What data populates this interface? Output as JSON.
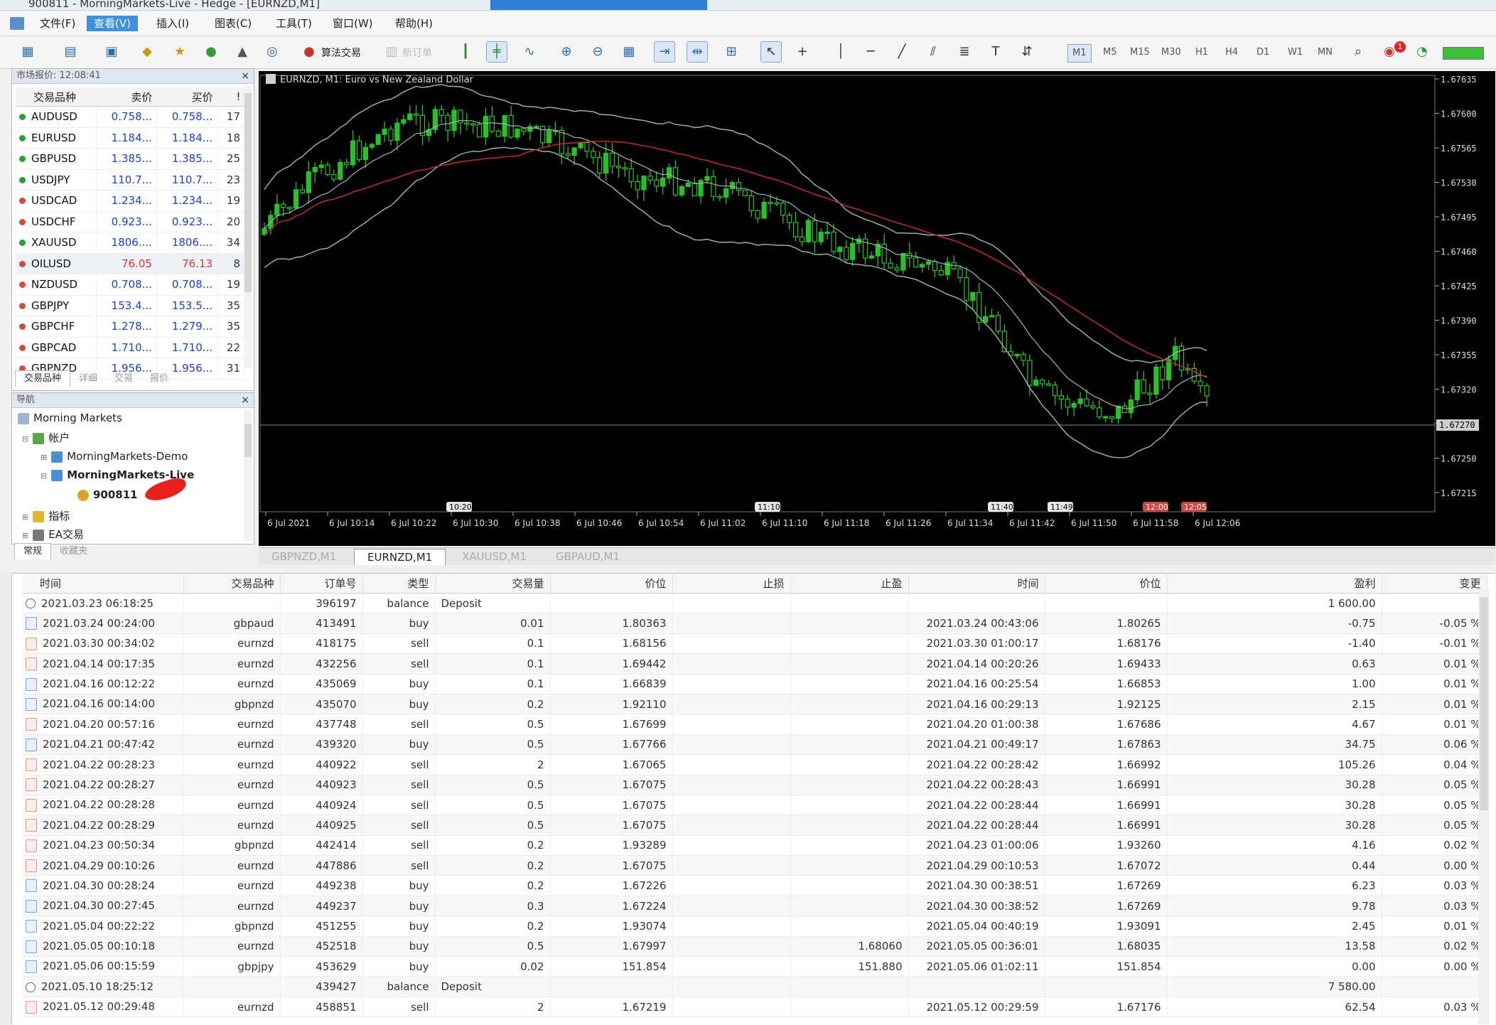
{
  "window": {
    "title": "900811 - MorningMarkets-Live - Hedge - [EURNZD,M1]"
  },
  "menu": [
    "文件(F)",
    "查看(V)",
    "插入(I)",
    "图表(C)",
    "工具(T)",
    "窗口(W)",
    "帮助(H)"
  ],
  "menu_active_index": 1,
  "toolbar": {
    "algo_label": "算法交易",
    "neworder_label": "新订单",
    "timeframes": [
      "M1",
      "M5",
      "M15",
      "M30",
      "H1",
      "H4",
      "D1",
      "W1",
      "MN"
    ],
    "active_timeframe": "M1",
    "notify_count": "1"
  },
  "market_watch": {
    "title": "市场报价: 12:08:41",
    "headers": {
      "symbol": "交易品种",
      "bid": "卖价",
      "ask": "买价",
      "spread": "!"
    },
    "rows": [
      {
        "symbol": "AUDUSD",
        "bid": "0.758...",
        "ask": "0.758...",
        "spread": "17",
        "dot": "#27a035"
      },
      {
        "symbol": "EURUSD",
        "bid": "1.184...",
        "ask": "1.184...",
        "spread": "18",
        "dot": "#27a035"
      },
      {
        "symbol": "GBPUSD",
        "bid": "1.385...",
        "ask": "1.385...",
        "spread": "25",
        "dot": "#27a035"
      },
      {
        "symbol": "USDJPY",
        "bid": "110.7...",
        "ask": "110.7...",
        "spread": "23",
        "dot": "#27a035"
      },
      {
        "symbol": "USDCAD",
        "bid": "1.234...",
        "ask": "1.234...",
        "spread": "19",
        "dot": "#d44b3a"
      },
      {
        "symbol": "USDCHF",
        "bid": "0.923...",
        "ask": "0.923...",
        "spread": "20",
        "dot": "#d44b3a"
      },
      {
        "symbol": "XAUUSD",
        "bid": "1806....",
        "ask": "1806....",
        "spread": "34",
        "dot": "#27a035"
      },
      {
        "symbol": "OILUSD",
        "bid": "76.05",
        "ask": "76.13",
        "spread": "8",
        "dot": "#d44b3a"
      },
      {
        "symbol": "NZDUSD",
        "bid": "0.708...",
        "ask": "0.708...",
        "spread": "19",
        "dot": "#d44b3a"
      },
      {
        "symbol": "GBPJPY",
        "bid": "153.4...",
        "ask": "153.5...",
        "spread": "35",
        "dot": "#d44b3a"
      },
      {
        "symbol": "GBPCHF",
        "bid": "1.278...",
        "ask": "1.279...",
        "spread": "35",
        "dot": "#d44b3a"
      },
      {
        "symbol": "GBPCAD",
        "bid": "1.710...",
        "ask": "1.710...",
        "spread": "22",
        "dot": "#d44b3a"
      },
      {
        "symbol": "GBPNZD",
        "bid": "1.956...",
        "ask": "1.956...",
        "spread": "31",
        "dot": "#d44b3a"
      }
    ],
    "tabs": [
      "交易品种",
      "详细",
      "交易",
      "报价"
    ]
  },
  "navigator": {
    "title": "导航",
    "root": "Morning Markets",
    "accounts_label": "帐户",
    "demo": "MorningMarkets-Demo",
    "live": "MorningMarkets-Live",
    "account_id": "900811",
    "indicators_label": "指标",
    "ea_label": "EA交易",
    "tabs": [
      "常规",
      "收藏夹"
    ]
  },
  "chart": {
    "symbol_label": "EURNZD, M1:  Euro vs New Zealand Dollar",
    "price_labels": [
      "1.67635",
      "1.67600",
      "1.67565",
      "1.67530",
      "1.67495",
      "1.67460",
      "1.67425",
      "1.67390",
      "1.67355",
      "1.67320",
      "1.67285",
      "1.67250",
      "1.67215"
    ],
    "current_price": "1.67270",
    "time_labels": [
      "6 Jul 2021",
      "6 Jul 10:14",
      "6 Jul 10:22",
      "6 Jul 10:30",
      "6 Jul 10:38",
      "6 Jul 10:46",
      "6 Jul 10:54",
      "6 Jul 11:02",
      "6 Jul 11:10",
      "6 Jul 11:18",
      "6 Jul 11:26",
      "6 Jul 11:34",
      "6 Jul 11:42",
      "6 Jul 11:50",
      "6 Jul 11:58",
      "6 Jul 12:06"
    ],
    "markers": [
      {
        "label": "10:20",
        "color": "#ffffff"
      },
      {
        "label": "11:10",
        "color": "#ffffff"
      },
      {
        "label": "11:40",
        "color": "#ffffff"
      },
      {
        "label": "11:49",
        "color": "#ffffff"
      },
      {
        "label": "12:00",
        "color": "#e05050"
      },
      {
        "label": "12:05",
        "color": "#e05050"
      }
    ],
    "candle_color": "#26c226",
    "band_color": "#9fb8b0",
    "ma_color": "#b52b2b"
  },
  "chart_tabs": [
    "GBPNZD,M1",
    "EURNZD,M1",
    "XAUUSD,M1",
    "GBPAUD,M1"
  ],
  "chart_tab_active": 1,
  "terminal": {
    "headers": [
      "时间",
      "交易品种",
      "订单号",
      "类型",
      "交易量",
      "价位",
      "止损",
      "止盈",
      "时间",
      "价位",
      "盈利",
      "变更"
    ],
    "rows": [
      {
        "icon": "bal",
        "time": "2021.03.23 06:18:25",
        "sym": "",
        "order": "396197",
        "type": "balance",
        "vol": "Deposit",
        "price": "",
        "sl": "",
        "tp": "",
        "ctime": "",
        "cprice": "",
        "profit": "1 600.00",
        "change": "",
        "pc": "zero"
      },
      {
        "icon": "buy",
        "time": "2021.03.24 00:24:00",
        "sym": "gbpaud",
        "order": "413491",
        "type": "buy",
        "vol": "0.01",
        "price": "1.80363",
        "sl": "",
        "tp": "",
        "ctime": "2021.03.24 00:43:06",
        "cprice": "1.80265",
        "profit": "-0.75",
        "change": "-0.05 %",
        "pc": "neg"
      },
      {
        "icon": "sell",
        "time": "2021.03.30 00:34:02",
        "sym": "eurnzd",
        "order": "418175",
        "type": "sell",
        "vol": "0.1",
        "price": "1.68156",
        "sl": "",
        "tp": "",
        "ctime": "2021.03.30 01:00:17",
        "cprice": "1.68176",
        "profit": "-1.40",
        "change": "-0.01 %",
        "pc": "neg"
      },
      {
        "icon": "sell",
        "time": "2021.04.14 00:17:35",
        "sym": "eurnzd",
        "order": "432256",
        "type": "sell",
        "vol": "0.1",
        "price": "1.69442",
        "sl": "",
        "tp": "",
        "ctime": "2021.04.14 00:20:26",
        "cprice": "1.69433",
        "profit": "0.63",
        "change": "0.01 %",
        "pc": "pos"
      },
      {
        "icon": "buy",
        "time": "2021.04.16 00:12:22",
        "sym": "eurnzd",
        "order": "435069",
        "type": "buy",
        "vol": "0.1",
        "price": "1.66839",
        "sl": "",
        "tp": "",
        "ctime": "2021.04.16 00:25:54",
        "cprice": "1.66853",
        "profit": "1.00",
        "change": "0.01 %",
        "pc": "pos"
      },
      {
        "icon": "buy",
        "time": "2021.04.16 00:14:00",
        "sym": "gbpnzd",
        "order": "435070",
        "type": "buy",
        "vol": "0.2",
        "price": "1.92110",
        "sl": "",
        "tp": "",
        "ctime": "2021.04.16 00:29:13",
        "cprice": "1.92125",
        "profit": "2.15",
        "change": "0.01 %",
        "pc": "pos"
      },
      {
        "icon": "sell",
        "time": "2021.04.20 00:57:16",
        "sym": "eurnzd",
        "order": "437748",
        "type": "sell",
        "vol": "0.5",
        "price": "1.67699",
        "sl": "",
        "tp": "",
        "ctime": "2021.04.20 01:00:38",
        "cprice": "1.67686",
        "profit": "4.67",
        "change": "0.01 %",
        "pc": "pos"
      },
      {
        "icon": "buy",
        "time": "2021.04.21 00:47:42",
        "sym": "eurnzd",
        "order": "439320",
        "type": "buy",
        "vol": "0.5",
        "price": "1.67766",
        "sl": "",
        "tp": "",
        "ctime": "2021.04.21 00:49:17",
        "cprice": "1.67863",
        "profit": "34.75",
        "change": "0.06 %",
        "pc": "pos"
      },
      {
        "icon": "sell",
        "time": "2021.04.22 00:28:23",
        "sym": "eurnzd",
        "order": "440922",
        "type": "sell",
        "vol": "2",
        "price": "1.67065",
        "sl": "",
        "tp": "",
        "ctime": "2021.04.22 00:28:42",
        "cprice": "1.66992",
        "profit": "105.26",
        "change": "0.04 %",
        "pc": "pos"
      },
      {
        "icon": "sell",
        "time": "2021.04.22 00:28:27",
        "sym": "eurnzd",
        "order": "440923",
        "type": "sell",
        "vol": "0.5",
        "price": "1.67075",
        "sl": "",
        "tp": "",
        "ctime": "2021.04.22 00:28:43",
        "cprice": "1.66991",
        "profit": "30.28",
        "change": "0.05 %",
        "pc": "pos"
      },
      {
        "icon": "sell",
        "time": "2021.04.22 00:28:28",
        "sym": "eurnzd",
        "order": "440924",
        "type": "sell",
        "vol": "0.5",
        "price": "1.67075",
        "sl": "",
        "tp": "",
        "ctime": "2021.04.22 00:28:44",
        "cprice": "1.66991",
        "profit": "30.28",
        "change": "0.05 %",
        "pc": "pos"
      },
      {
        "icon": "sell",
        "time": "2021.04.22 00:28:29",
        "sym": "eurnzd",
        "order": "440925",
        "type": "sell",
        "vol": "0.5",
        "price": "1.67075",
        "sl": "",
        "tp": "",
        "ctime": "2021.04.22 00:28:44",
        "cprice": "1.66991",
        "profit": "30.28",
        "change": "0.05 %",
        "pc": "pos"
      },
      {
        "icon": "sell",
        "time": "2021.04.23 00:50:34",
        "sym": "gbpnzd",
        "order": "442414",
        "type": "sell",
        "vol": "0.2",
        "price": "1.93289",
        "sl": "",
        "tp": "",
        "ctime": "2021.04.23 01:00:06",
        "cprice": "1.93260",
        "profit": "4.16",
        "change": "0.02 %",
        "pc": "pos"
      },
      {
        "icon": "sell",
        "time": "2021.04.29 00:10:26",
        "sym": "eurnzd",
        "order": "447886",
        "type": "sell",
        "vol": "0.2",
        "price": "1.67075",
        "sl": "",
        "tp": "",
        "ctime": "2021.04.29 00:10:53",
        "cprice": "1.67072",
        "profit": "0.44",
        "change": "0.00 %",
        "pc": "pos"
      },
      {
        "icon": "buy",
        "time": "2021.04.30 00:28:24",
        "sym": "eurnzd",
        "order": "449238",
        "type": "buy",
        "vol": "0.2",
        "price": "1.67226",
        "sl": "",
        "tp": "",
        "ctime": "2021.04.30 00:38:51",
        "cprice": "1.67269",
        "profit": "6.23",
        "change": "0.03 %",
        "pc": "pos"
      },
      {
        "icon": "buy",
        "time": "2021.04.30 00:27:45",
        "sym": "eurnzd",
        "order": "449237",
        "type": "buy",
        "vol": "0.3",
        "price": "1.67224",
        "sl": "",
        "tp": "",
        "ctime": "2021.04.30 00:38:52",
        "cprice": "1.67269",
        "profit": "9.78",
        "change": "0.03 %",
        "pc": "pos"
      },
      {
        "icon": "buy",
        "time": "2021.05.04 00:22:22",
        "sym": "gbpnzd",
        "order": "451255",
        "type": "buy",
        "vol": "0.2",
        "price": "1.93074",
        "sl": "",
        "tp": "",
        "ctime": "2021.05.04 00:40:19",
        "cprice": "1.93091",
        "profit": "2.45",
        "change": "0.01 %",
        "pc": "pos"
      },
      {
        "icon": "buy",
        "time": "2021.05.05 00:10:18",
        "sym": "eurnzd",
        "order": "452518",
        "type": "buy",
        "vol": "0.5",
        "price": "1.67997",
        "sl": "",
        "tp": "1.68060",
        "ctime": "2021.05.05 00:36:01",
        "cprice": "1.68035",
        "profit": "13.58",
        "change": "0.02 %",
        "pc": "pos"
      },
      {
        "icon": "buy",
        "time": "2021.05.06 00:15:59",
        "sym": "gbpjpy",
        "order": "453629",
        "type": "buy",
        "vol": "0.02",
        "price": "151.854",
        "sl": "",
        "tp": "151.880",
        "ctime": "2021.05.06 01:02:11",
        "cprice": "151.854",
        "profit": "0.00",
        "change": "0.00 %",
        "pc": "zero"
      },
      {
        "icon": "bal",
        "time": "2021.05.10 18:25:12",
        "sym": "",
        "order": "439427",
        "type": "balance",
        "vol": "Deposit",
        "price": "",
        "sl": "",
        "tp": "",
        "ctime": "",
        "cprice": "",
        "profit": "7 580.00",
        "change": "",
        "pc": "zero"
      },
      {
        "icon": "sell",
        "time": "2021.05.12 00:29:48",
        "sym": "eurnzd",
        "order": "458851",
        "type": "sell",
        "vol": "2",
        "price": "1.67219",
        "sl": "",
        "tp": "",
        "ctime": "2021.05.12 00:29:59",
        "cprice": "1.67176",
        "profit": "62.54",
        "change": "0.03 %",
        "pc": "pos"
      }
    ]
  }
}
